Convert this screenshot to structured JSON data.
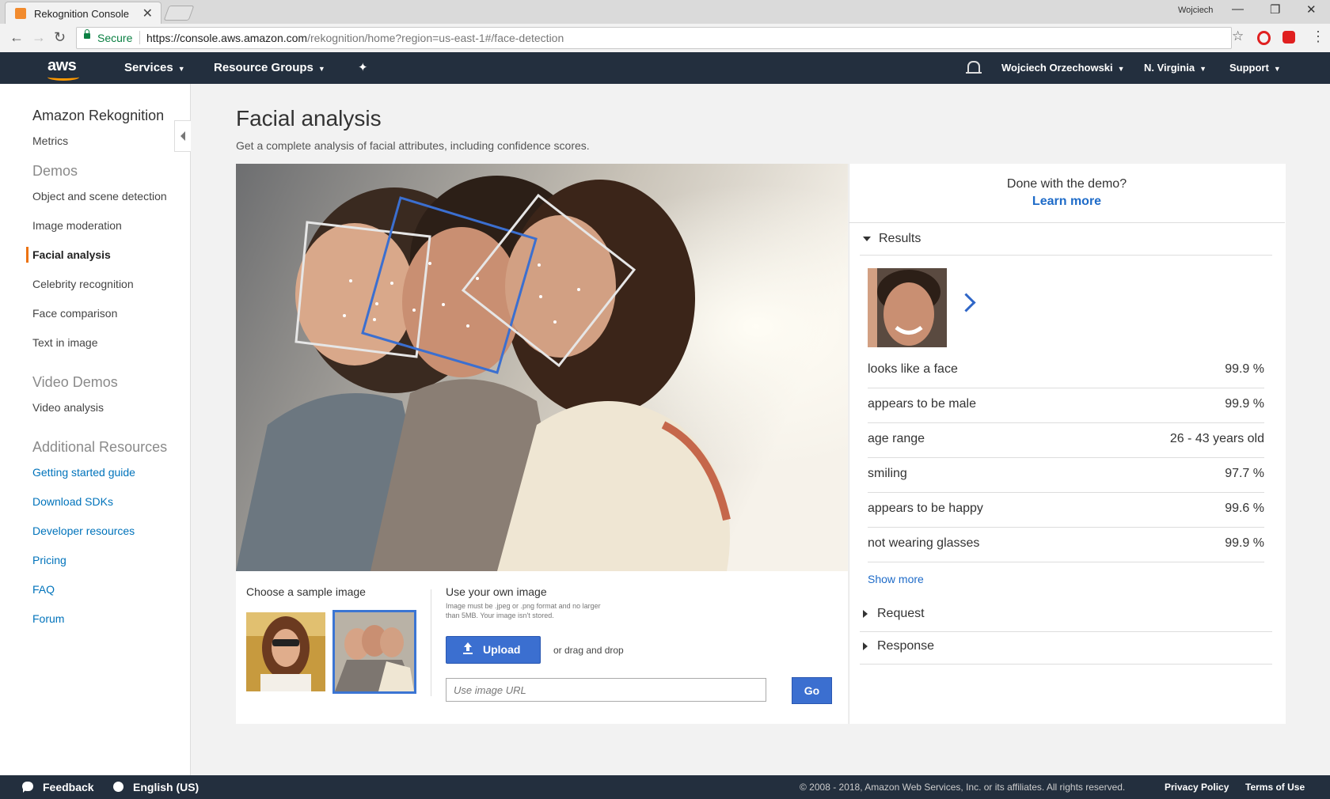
{
  "browser": {
    "tab_title": "Rekognition Console",
    "window_user": "Wojciech",
    "secure_label": "Secure",
    "url_host": "https://console.aws.amazon.com",
    "url_path": "/rekognition/home?region=us-east-1#/face-detection"
  },
  "topnav": {
    "logo": "aws",
    "services": "Services",
    "resource_groups": "Resource Groups",
    "user": "Wojciech Orzechowski",
    "region": "N. Virginia",
    "support": "Support"
  },
  "sidebar": {
    "title": "Amazon Rekognition",
    "metrics": "Metrics",
    "demos_heading": "Demos",
    "demos": [
      "Object and scene detection",
      "Image moderation",
      "Facial analysis",
      "Celebrity recognition",
      "Face comparison",
      "Text in image"
    ],
    "video_heading": "Video Demos",
    "video": [
      "Video analysis"
    ],
    "resources_heading": "Additional Resources",
    "resources": [
      "Getting started guide",
      "Download SDKs",
      "Developer resources",
      "Pricing",
      "FAQ",
      "Forum"
    ]
  },
  "main": {
    "title": "Facial analysis",
    "subtitle": "Get a complete analysis of facial attributes, including confidence scores.",
    "sample_title": "Choose a sample image",
    "own_title": "Use your own image",
    "own_note": "Image must be .jpeg or .png format and no larger than 5MB. Your image isn't stored.",
    "upload_label": "Upload",
    "drag_text": "or drag and drop",
    "url_placeholder": "Use image URL",
    "go_label": "Go"
  },
  "results": {
    "done_text": "Done with the demo?",
    "learn_more": "Learn more",
    "results_label": "Results",
    "rows": [
      {
        "label": "looks like a face",
        "value": "99.9 %"
      },
      {
        "label": "appears to be male",
        "value": "99.9 %"
      },
      {
        "label": "age range",
        "value": "26 - 43 years old"
      },
      {
        "label": "smiling",
        "value": "97.7 %"
      },
      {
        "label": "appears to be happy",
        "value": "99.6 %"
      },
      {
        "label": "not wearing glasses",
        "value": "99.9 %"
      }
    ],
    "show_more": "Show more",
    "request_label": "Request",
    "response_label": "Response"
  },
  "footer": {
    "feedback": "Feedback",
    "language": "English (US)",
    "copyright": "© 2008 - 2018, Amazon Web Services, Inc. or its affiliates. All rights reserved.",
    "privacy": "Privacy Policy",
    "terms": "Terms of Use"
  },
  "colors": {
    "aws_nav": "#232f3e",
    "accent_orange": "#ec7211",
    "link_blue": "#0073bb",
    "button_blue": "#3b6fd0"
  }
}
